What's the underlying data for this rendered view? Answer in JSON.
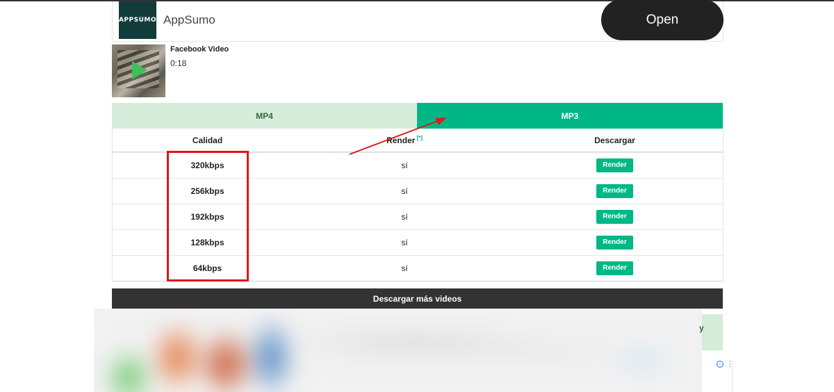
{
  "ad": {
    "logo_text": "APPSUMO",
    "name": "AppSumo",
    "open_label": "Open"
  },
  "video": {
    "title": "Facebook Video",
    "duration": "0:18"
  },
  "tabs": [
    {
      "label": "MP4",
      "active": false
    },
    {
      "label": "MP3",
      "active": true
    }
  ],
  "table": {
    "headers": {
      "quality": "Calidad",
      "render": "Render",
      "render_note": "[*]",
      "download": "Descargar"
    },
    "rows": [
      {
        "quality": "320kbps",
        "render": "sí",
        "button": "Render"
      },
      {
        "quality": "256kbps",
        "render": "sí",
        "button": "Render"
      },
      {
        "quality": "192kbps",
        "render": "sí",
        "button": "Render"
      },
      {
        "quality": "128kbps",
        "render": "sí",
        "button": "Render"
      },
      {
        "quality": "64kbps",
        "render": "sí",
        "button": "Render"
      }
    ]
  },
  "more_videos_label": "Descargar más videos",
  "side_ad": {
    "letter": "y",
    "info_icon": "ⓘ",
    "menu_icon": "⋮"
  },
  "colors": {
    "accent_green": "#00b785",
    "tab_inactive": "#d6eddb",
    "annotation_red": "#e01414",
    "dark_bar": "#333333"
  }
}
